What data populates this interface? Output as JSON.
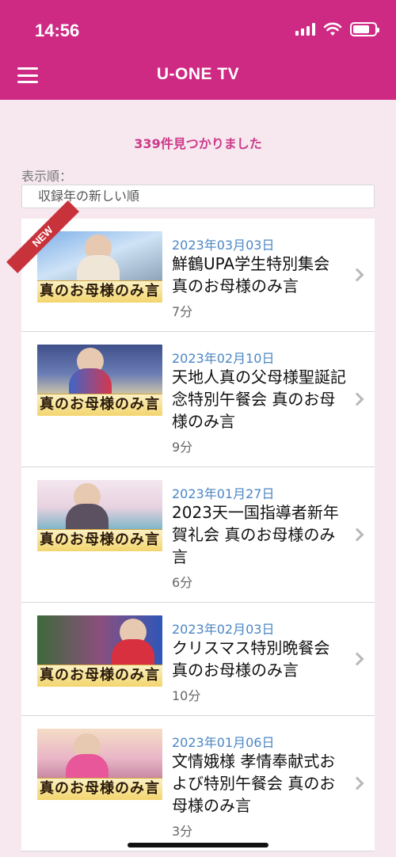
{
  "status": {
    "time": "14:56",
    "icons": [
      "signal-icon",
      "wifi-icon",
      "battery-icon"
    ]
  },
  "header": {
    "title": "U-ONE TV",
    "menu_icon": "hamburger-menu-icon"
  },
  "results": {
    "count_text": "339件見つかりました"
  },
  "sort": {
    "label": "表示順：",
    "selected": "収録年の新しい順"
  },
  "thumbnail_caption": "真のお母様のみ言",
  "new_badge": "NEW",
  "items": [
    {
      "date": "2023年03月03日",
      "title": "鮮鶴UPA学生特別集会 真のお母様のみ言",
      "duration": "7分"
    },
    {
      "date": "2023年02月10日",
      "title": "天地人真の父母様聖誕記念特別午餐会 真のお母様のみ言",
      "duration": "9分"
    },
    {
      "date": "2023年01月27日",
      "title": "2023天一国指導者新年賀礼会 真のお母様のみ言",
      "duration": "6分"
    },
    {
      "date": "2023年02月03日",
      "title": "クリスマス特別晩餐会 真のお母様のみ言",
      "duration": "10分"
    },
    {
      "date": "2023年01月06日",
      "title": "文情娥様 孝情奉献式および特別午餐会 真のお母様のみ言",
      "duration": "3分"
    }
  ],
  "colors": {
    "header": "#cf2a83",
    "accent": "#cc3a8b",
    "date": "#4a86c5",
    "badge": "#c8323b",
    "background": "#f6e8ee"
  }
}
